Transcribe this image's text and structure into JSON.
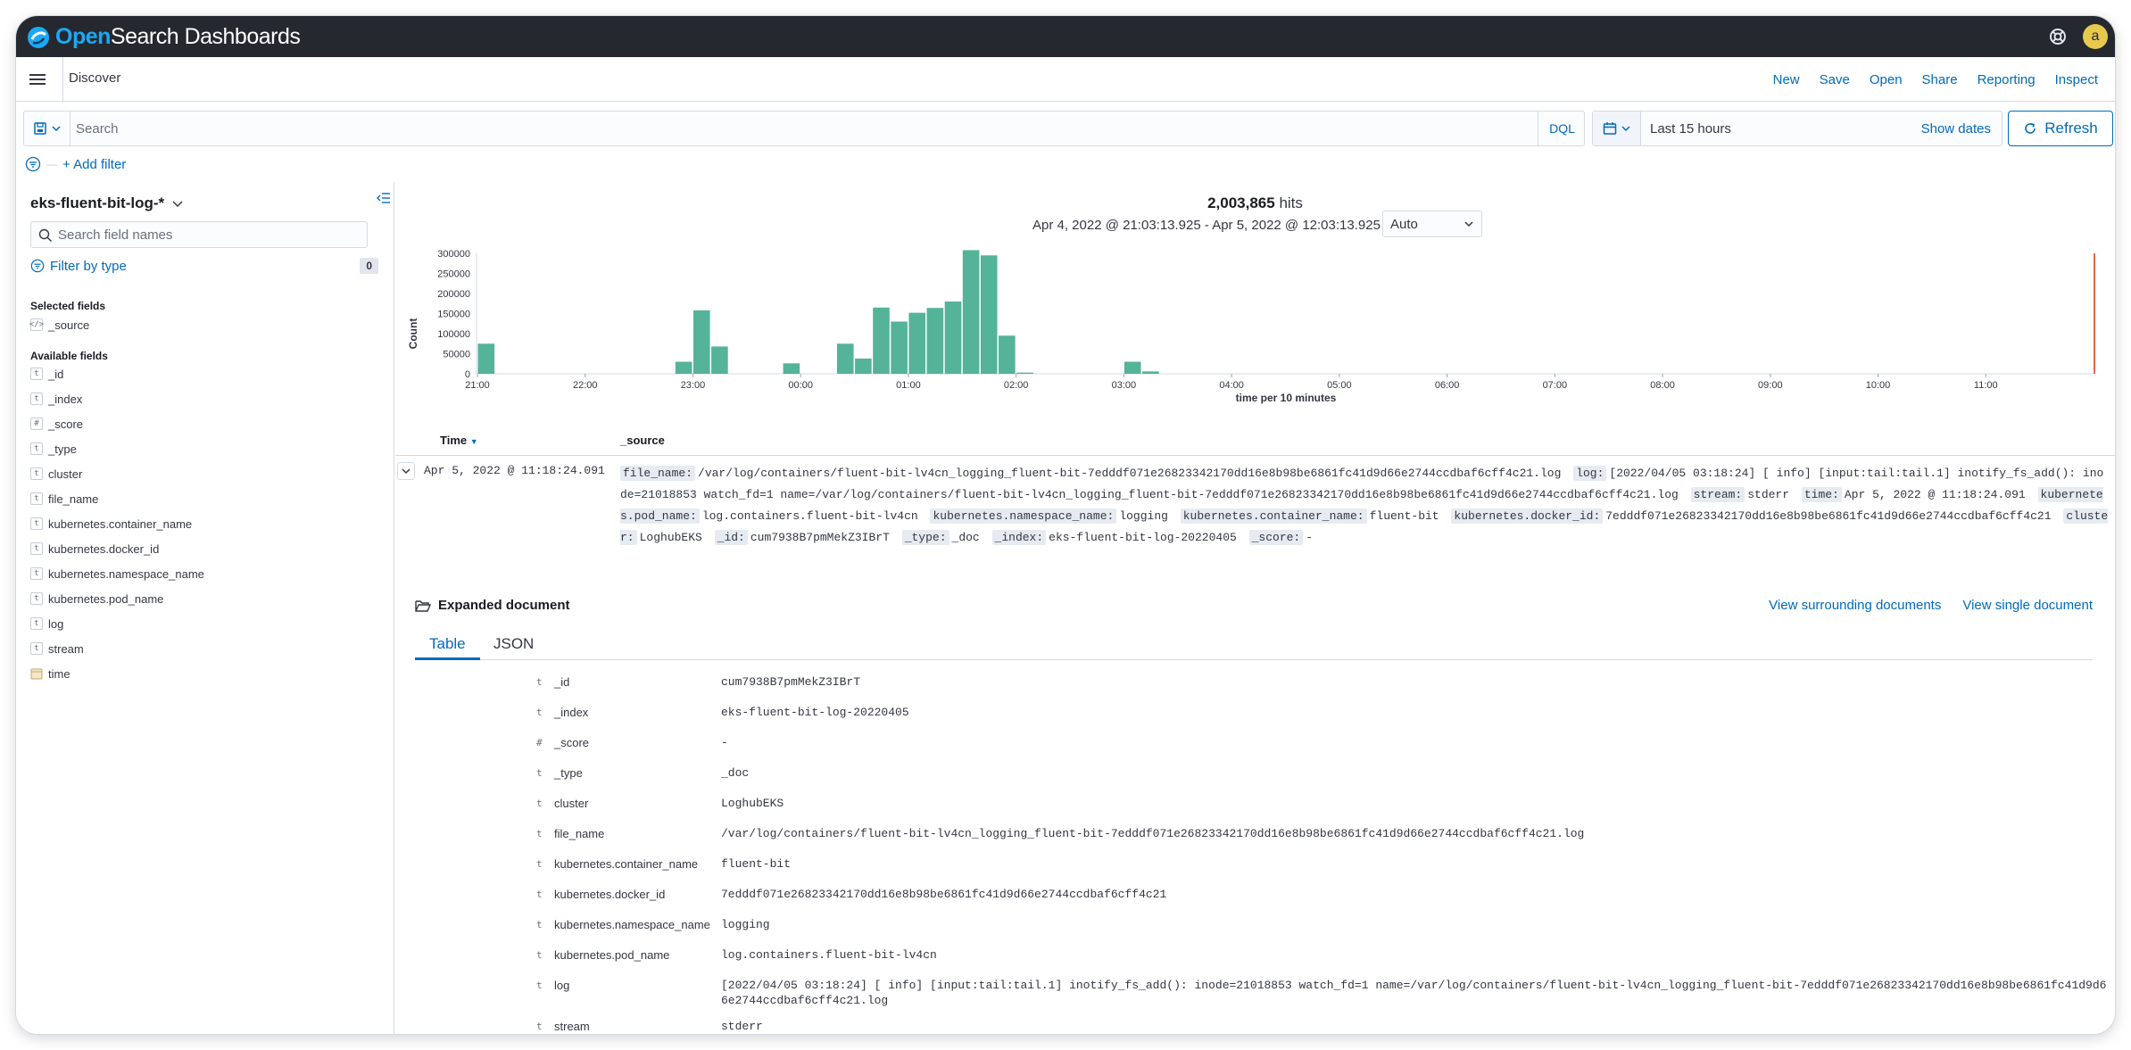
{
  "header": {
    "brand_open": "Open",
    "brand_rest": "Search Dashboards",
    "avatar_letter": "a"
  },
  "appbar": {
    "title": "Discover",
    "links": [
      "New",
      "Save",
      "Open",
      "Share",
      "Reporting",
      "Inspect"
    ]
  },
  "query": {
    "placeholder": "Search",
    "language": "DQL",
    "time_label": "Last 15 hours",
    "show_dates": "Show dates",
    "refresh": "Refresh"
  },
  "filters": {
    "add_filter": "+ Add filter"
  },
  "sidebar": {
    "index_pattern": "eks-fluent-bit-log-*",
    "search_placeholder": "Search field names",
    "filter_by_type": "Filter by type",
    "filter_count": "0",
    "selected_title": "Selected fields",
    "selected_fields": [
      {
        "type": "</>",
        "name": "_source"
      }
    ],
    "available_title": "Available fields",
    "available_fields": [
      {
        "type": "t",
        "name": "_id"
      },
      {
        "type": "t",
        "name": "_index"
      },
      {
        "type": "#",
        "name": "_score"
      },
      {
        "type": "t",
        "name": "_type"
      },
      {
        "type": "t",
        "name": "cluster"
      },
      {
        "type": "t",
        "name": "file_name"
      },
      {
        "type": "t",
        "name": "kubernetes.container_name"
      },
      {
        "type": "t",
        "name": "kubernetes.docker_id"
      },
      {
        "type": "t",
        "name": "kubernetes.namespace_name"
      },
      {
        "type": "t",
        "name": "kubernetes.pod_name"
      },
      {
        "type": "t",
        "name": "log"
      },
      {
        "type": "t",
        "name": "stream"
      },
      {
        "type": "cal",
        "name": "time"
      }
    ]
  },
  "summary": {
    "hits_count": "2,003,865",
    "hits_label": "hits",
    "range": "Apr 4, 2022 @ 21:03:13.925 - Apr 5, 2022 @ 12:03:13.925",
    "interval": "Auto"
  },
  "chart_data": {
    "type": "bar",
    "title": "",
    "xlabel": "time per 10 minutes",
    "ylabel": "Count",
    "ylim": [
      0,
      300000
    ],
    "yticks": [
      0,
      50000,
      100000,
      150000,
      200000,
      250000,
      300000
    ],
    "xticks": [
      "21:00",
      "22:00",
      "23:00",
      "00:00",
      "01:00",
      "02:00",
      "03:00",
      "04:00",
      "05:00",
      "06:00",
      "07:00",
      "08:00",
      "09:00",
      "10:00",
      "11:00"
    ],
    "start_hour": 21,
    "x_span_hours": 15,
    "bin_minutes": 10,
    "first_bin_minute": 0,
    "grid": false,
    "color": "#54b399",
    "now_marker_color": "#e7664c",
    "values": [
      75000,
      0,
      0,
      0,
      0,
      0,
      0,
      0,
      0,
      0,
      0,
      30000,
      158000,
      68000,
      0,
      0,
      0,
      26000,
      0,
      0,
      75000,
      38000,
      165000,
      130000,
      152000,
      164000,
      180000,
      308000,
      295000,
      95000,
      3000,
      0,
      0,
      0,
      0,
      0,
      30000,
      6000,
      0,
      0,
      0,
      0,
      0,
      0,
      0,
      0,
      0,
      0,
      0,
      0,
      0,
      0,
      0,
      0,
      0,
      0,
      0,
      0,
      0,
      0,
      0,
      0,
      0,
      0,
      0,
      0,
      0,
      0,
      0,
      0,
      0,
      0,
      0,
      0,
      0,
      0,
      0,
      0,
      0,
      0,
      0,
      0,
      0,
      0,
      0,
      0,
      0,
      0,
      0,
      0,
      0,
      0,
      0,
      0,
      0,
      0,
      0,
      0,
      0,
      0,
      0,
      0,
      0,
      0,
      0,
      0,
      0,
      0,
      0,
      0,
      0,
      0,
      0,
      0,
      0,
      0,
      0,
      0,
      0,
      0,
      0,
      0,
      0,
      0,
      0,
      0,
      0,
      0,
      0,
      0,
      0,
      0,
      0,
      0,
      0,
      0,
      0,
      0,
      0,
      0,
      0,
      0,
      0,
      0,
      0,
      0,
      0,
      0,
      0,
      0,
      0,
      0,
      0,
      0,
      0,
      0,
      0,
      0,
      0,
      0,
      0,
      0,
      0,
      0,
      0,
      0,
      0,
      0,
      0,
      0,
      0,
      0,
      0,
      0,
      0,
      5000,
      0,
      0,
      0,
      0,
      0,
      0,
      0
    ]
  },
  "table": {
    "col_time": "Time",
    "col_source": "_source",
    "row": {
      "time": "Apr 5, 2022 @ 11:18:24.091",
      "pairs": [
        [
          "file_name:",
          "/var/log/containers/fluent-bit-lv4cn_logging_fluent-bit-7edddf071e26823342170dd16e8b98be6861fc41d9d66e2744ccdbaf6cff4c21.log"
        ],
        [
          "log:",
          "[2022/04/05 03:18:24] [ info] [input:tail:tail.1] inotify_fs_add(): inode=21018853 watch_fd=1 name=/var/log/containers/fluent-bit-lv4cn_logging_fluent-bit-7edddf071e26823342170dd16e8b98be6861fc41d9d66e2744ccdbaf6cff4c21.log"
        ],
        [
          "stream:",
          "stderr"
        ],
        [
          "time:",
          "Apr 5, 2022 @ 11:18:24.091"
        ],
        [
          "kubernetes.pod_name:",
          "log.containers.fluent-bit-lv4cn"
        ],
        [
          "kubernetes.namespace_name:",
          "logging"
        ],
        [
          "kubernetes.container_name:",
          "fluent-bit"
        ],
        [
          "kubernetes.docker_id:",
          "7edddf071e26823342170dd16e8b98be6861fc41d9d66e2744ccdbaf6cff4c21"
        ],
        [
          "cluster:",
          "LoghubEKS"
        ],
        [
          "_id:",
          "cum7938B7pmMekZ3IBrT"
        ],
        [
          "_type:",
          "_doc"
        ],
        [
          "_index:",
          "eks-fluent-bit-log-20220405"
        ],
        [
          "_score:",
          "-"
        ]
      ]
    }
  },
  "expanded": {
    "title": "Expanded document",
    "view_surrounding": "View surrounding documents",
    "view_single": "View single document",
    "tabs": [
      "Table",
      "JSON"
    ],
    "fields": [
      {
        "type": "t",
        "key": "_id",
        "value": "cum7938B7pmMekZ3IBrT"
      },
      {
        "type": "t",
        "key": "_index",
        "value": "eks-fluent-bit-log-20220405"
      },
      {
        "type": "#",
        "key": "_score",
        "value": " -"
      },
      {
        "type": "t",
        "key": "_type",
        "value": "_doc"
      },
      {
        "type": "t",
        "key": "cluster",
        "value": "LoghubEKS"
      },
      {
        "type": "t",
        "key": "file_name",
        "value": "/var/log/containers/fluent-bit-lv4cn_logging_fluent-bit-7edddf071e26823342170dd16e8b98be6861fc41d9d66e2744ccdbaf6cff4c21.log"
      },
      {
        "type": "t",
        "key": "kubernetes.container_name",
        "value": "fluent-bit"
      },
      {
        "type": "t",
        "key": "kubernetes.docker_id",
        "value": "7edddf071e26823342170dd16e8b98be6861fc41d9d66e2744ccdbaf6cff4c21"
      },
      {
        "type": "t",
        "key": "kubernetes.namespace_name",
        "value": "logging"
      },
      {
        "type": "t",
        "key": "kubernetes.pod_name",
        "value": "log.containers.fluent-bit-lv4cn"
      },
      {
        "type": "t",
        "key": "log",
        "value": "[2022/04/05 03:18:24] [ info] [input:tail:tail.1] inotify_fs_add(): inode=21018853 watch_fd=1 name=/var/log/containers/fluent-bit-lv4cn_logging_fluent-bit-7edddf071e26823342170dd16e8b98be6861fc41d9d66e2744ccdbaf6cff4c21.log"
      },
      {
        "type": "t",
        "key": "stream",
        "value": "stderr"
      }
    ]
  }
}
